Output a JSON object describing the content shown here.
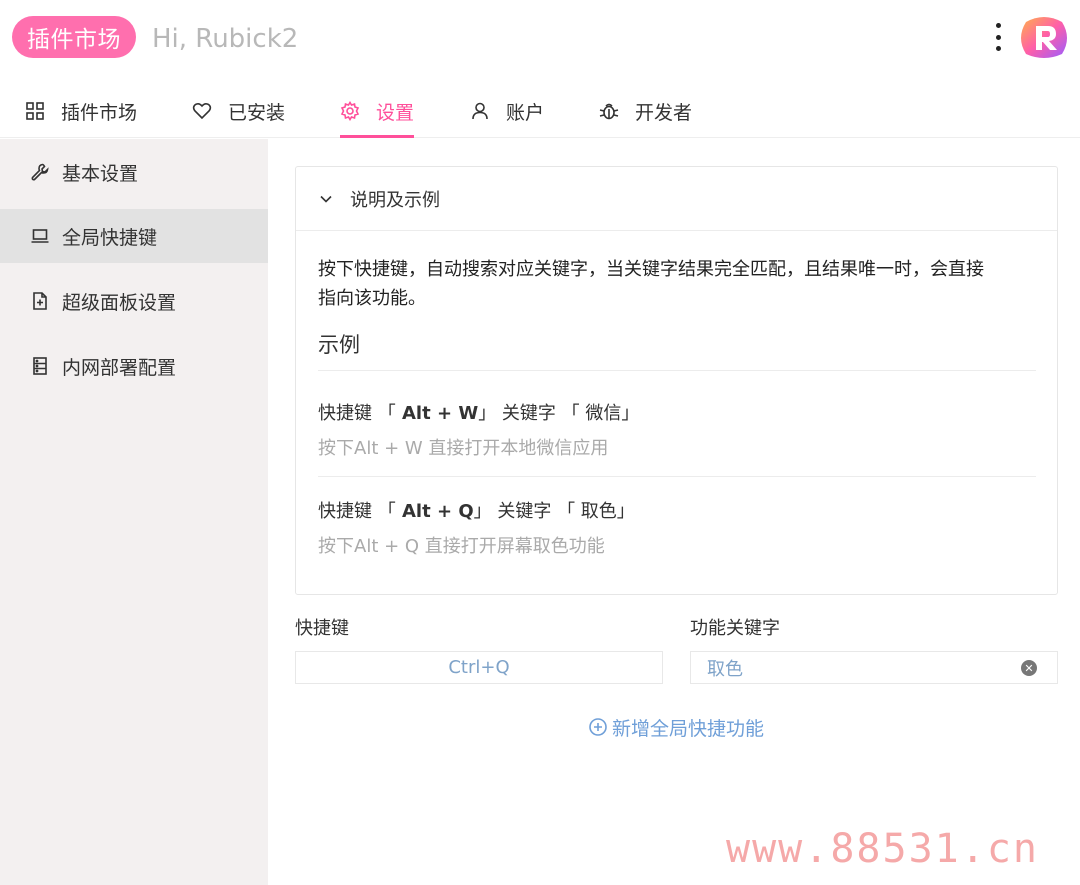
{
  "header": {
    "brand": "插件市场",
    "greeting": "Hi, Rubick2"
  },
  "nav": {
    "items": [
      {
        "label": "插件市场",
        "icon": "grid-icon"
      },
      {
        "label": "已安装",
        "icon": "heart-icon"
      },
      {
        "label": "设置",
        "icon": "gear-icon",
        "active": true
      },
      {
        "label": "账户",
        "icon": "user-icon"
      },
      {
        "label": "开发者",
        "icon": "bug-icon"
      }
    ]
  },
  "sidebar": {
    "items": [
      {
        "label": "基本设置",
        "icon": "wrench-icon"
      },
      {
        "label": "全局快捷键",
        "icon": "laptop-icon",
        "active": true
      },
      {
        "label": "超级面板设置",
        "icon": "file-add-icon"
      },
      {
        "label": "内网部署配置",
        "icon": "database-icon"
      }
    ]
  },
  "panel": {
    "title": "说明及示例",
    "description_line1": "按下快捷键，自动搜索对应关键字，当关键字结果完全匹配，且结果唯一时，会直接",
    "description_line2": "指向该功能。",
    "example_title": "示例",
    "examples": [
      {
        "prefix": "快捷键 「",
        "shortcut": " Alt + W",
        "middle": "」 关键字 「 ",
        "keyword": "微信",
        "suffix": "」",
        "desc": "按下Alt + W 直接打开本地微信应用"
      },
      {
        "prefix": "快捷键 「",
        "shortcut": " Alt + Q",
        "middle": "」 关键字 「 ",
        "keyword": "取色",
        "suffix": "」",
        "desc": "按下Alt + Q 直接打开屏幕取色功能"
      }
    ]
  },
  "form": {
    "shortcut_label": "快捷键",
    "keyword_label": "功能关键字",
    "shortcut_value": "Ctrl+Q",
    "keyword_value": "取色",
    "clear_glyph": "✕",
    "add_label": "新增全局快捷功能"
  },
  "watermark": "www.88531.cn",
  "colors": {
    "accent": "#ff4f9a",
    "brand_pill": "#ff6fae",
    "link": "#6f9fd8",
    "sidebar_bg": "#f3f0f0"
  }
}
